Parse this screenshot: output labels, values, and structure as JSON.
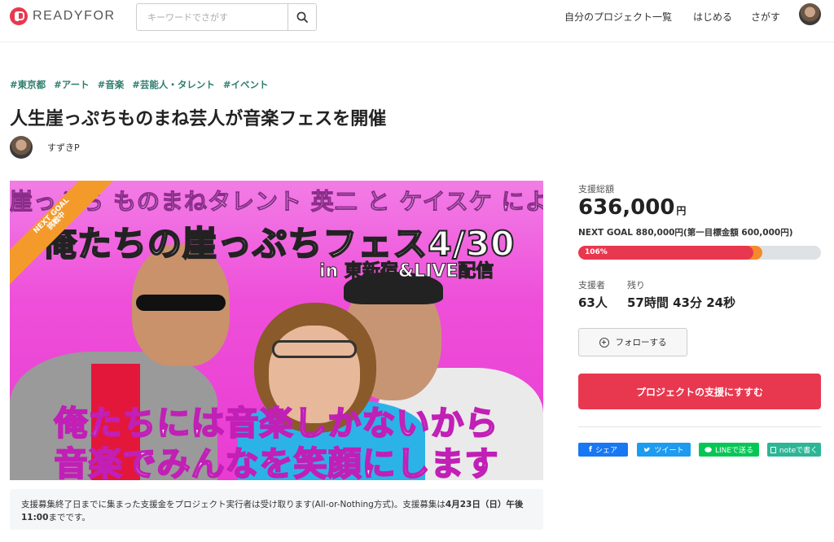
{
  "header": {
    "logo_text": "READYFOR",
    "search_placeholder": "キーワードでさがす",
    "nav": [
      "自分のプロジェクト一覧",
      "はじめる",
      "さがす"
    ]
  },
  "project": {
    "tags": [
      "#東京都",
      "#アート",
      "#音楽",
      "#芸能人・タレント",
      "#イベント"
    ],
    "title": "人生崖っぷちものまね芸人が音楽フェスを開催",
    "owner": "すずきP"
  },
  "hero": {
    "line1": "崖っぷち ものまねタレント 英二 と ケイスケ による",
    "line2": "俺たちの崖っぷちフェス4/30",
    "line3": "in 東新宿&LIVE配信",
    "bottom1": "俺たちには音楽しかないから",
    "bottom2": "音楽でみんなを笑顔にします",
    "ribbon_line1": "NEXT GOAL",
    "ribbon_line2": "挑戦中"
  },
  "notice": {
    "text_before": "支援募集終了日までに集まった支援金をプロジェクト実行者は受け取ります(All-or-Nothing方式)。支援募集は",
    "deadline": "4月23日（日）午後11:00",
    "text_after": "までです。"
  },
  "sidebar": {
    "total_label": "支援総額",
    "total_amount": "636,000",
    "currency": "円",
    "next_goal": "NEXT GOAL 880,000円(第一目標金額 600,000円)",
    "progress_label": "106%",
    "progress_fraction": 0.72,
    "supporters_label": "支援者",
    "supporters_value": "63人",
    "remaining_label": "残り",
    "remaining_value": "57時間 43分 24秒",
    "follow_label": "フォローする",
    "support_button": "プロジェクトの支援にすすむ",
    "share": {
      "facebook": "シェア",
      "twitter": "ツイート",
      "line": "LINEで送る",
      "note": "noteで書く"
    }
  },
  "colors": {
    "accent": "#e8384f",
    "tag": "#2e7d6f",
    "facebook": "#1877f2",
    "twitter": "#1d9bf0",
    "line": "#06c755",
    "note": "#2cb696"
  }
}
